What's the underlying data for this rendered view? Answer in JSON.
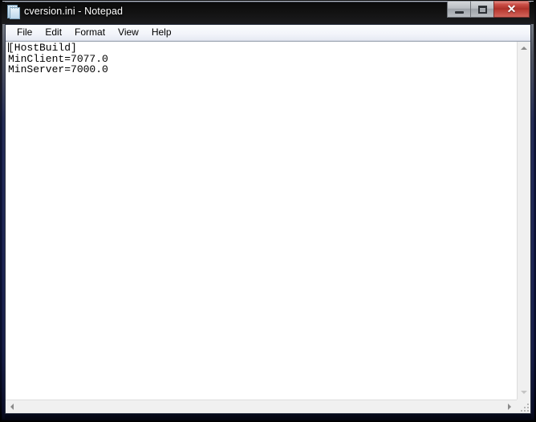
{
  "window": {
    "title": "cversion.ini - Notepad",
    "icon": "notepad-document-icon",
    "frame_style": "windows-aero-dark-glass",
    "accent_close_color": "#b83a31",
    "client_background": "#ffffff"
  },
  "titlebar_controls": {
    "minimize_label": "",
    "minimize_tooltip": "Minimize",
    "maximize_label": "",
    "maximize_tooltip": "Maximize",
    "close_label": "✕",
    "close_tooltip": "Close"
  },
  "menubar": {
    "items": [
      {
        "label": "File"
      },
      {
        "label": "Edit"
      },
      {
        "label": "Format"
      },
      {
        "label": "View"
      },
      {
        "label": "Help"
      }
    ]
  },
  "document": {
    "filename": "cversion.ini",
    "lines": [
      "[HostBuild]",
      "MinClient=7077.0",
      "MinServer=7000.0"
    ],
    "caret_line": 0,
    "caret_column": 0
  },
  "scrollbars": {
    "vertical": {
      "up_arrow": "scroll-up-arrow-icon",
      "down_arrow": "scroll-down-arrow-icon",
      "thumb_visible": false
    },
    "horizontal": {
      "left_arrow": "scroll-left-arrow-icon",
      "right_arrow": "scroll-right-arrow-icon",
      "thumb_visible": false
    },
    "resize_grip": "resize-grip-icon"
  }
}
